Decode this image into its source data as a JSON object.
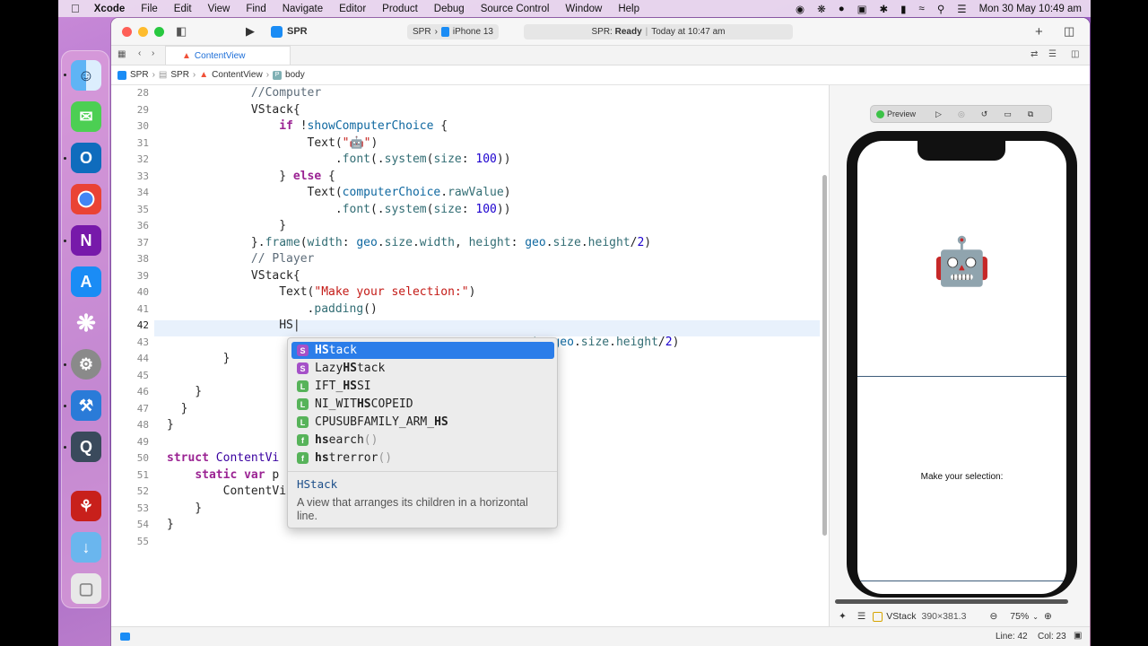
{
  "menubar": {
    "app_name": "Xcode",
    "items": [
      "File",
      "Edit",
      "View",
      "Find",
      "Navigate",
      "Editor",
      "Product",
      "Debug",
      "Source Control",
      "Window",
      "Help"
    ],
    "datetime": "Mon 30 May  10:49 am"
  },
  "toolbar": {
    "project": "SPR",
    "scheme": "SPR",
    "device": "iPhone 13",
    "status_prefix": "SPR:",
    "status_state": "Ready",
    "status_time": "Today at 10:47 am"
  },
  "tab": {
    "label": "ContentView"
  },
  "jumpbar": {
    "items": [
      "SPR",
      "SPR",
      "ContentView",
      "body"
    ]
  },
  "editor": {
    "lines": [
      {
        "n": "28",
        "html": "            <span class=\"cm\">//Computer</span>"
      },
      {
        "n": "29",
        "html": "            VStack{"
      },
      {
        "n": "30",
        "html": "                <span class=\"kw\">if</span> !<span class=\"id\">showComputerChoice</span> {"
      },
      {
        "n": "31",
        "html": "                    Text(<span class=\"str\">\"🤖\"</span>)"
      },
      {
        "n": "32",
        "html": "                        .<span class=\"pr\">font</span>(.<span class=\"pr\">system</span>(<span class=\"pr\">size</span>: <span class=\"nm\">100</span>))"
      },
      {
        "n": "33",
        "html": "                } <span class=\"kw\">else</span> {"
      },
      {
        "n": "34",
        "html": "                    Text(<span class=\"id\">computerChoice</span>.<span class=\"pr\">rawValue</span>)"
      },
      {
        "n": "35",
        "html": "                        .<span class=\"pr\">font</span>(.<span class=\"pr\">system</span>(<span class=\"pr\">size</span>: <span class=\"nm\">100</span>))"
      },
      {
        "n": "36",
        "html": "                }"
      },
      {
        "n": "37",
        "html": "            }.<span class=\"pr\">frame</span>(<span class=\"pr\">width</span>: <span class=\"id\">geo</span>.<span class=\"pr\">size</span>.<span class=\"pr\">width</span>, <span class=\"pr\">height</span>: <span class=\"id\">geo</span>.<span class=\"pr\">size</span>.<span class=\"pr\">height</span>/<span class=\"nm\">2</span>)"
      },
      {
        "n": "38",
        "html": "            <span class=\"cm\">// Player</span>"
      },
      {
        "n": "39",
        "html": "            VStack{"
      },
      {
        "n": "40",
        "html": "                Text(<span class=\"str\">\"Make your selection:\"</span>)"
      },
      {
        "n": "41",
        "html": "                    .<span class=\"pr\">padding</span>()"
      },
      {
        "n": "42",
        "html": "                HS|"
      },
      {
        "n": "43",
        "html": "                                                    <span class=\"pr\">t</span>: <span class=\"id\">geo</span>.<span class=\"pr\">size</span>.<span class=\"pr\">height</span>/<span class=\"nm\">2</span>)"
      },
      {
        "n": "44",
        "html": "        }"
      },
      {
        "n": "45",
        "html": ""
      },
      {
        "n": "46",
        "html": "    }"
      },
      {
        "n": "47",
        "html": "  }"
      },
      {
        "n": "48",
        "html": "}"
      },
      {
        "n": "49",
        "html": ""
      },
      {
        "n": "50",
        "html": "<span class=\"kw\">struct</span> <span class=\"ty\">ContentVi</span>"
      },
      {
        "n": "51",
        "html": "    <span class=\"kw\">static var</span> p"
      },
      {
        "n": "52",
        "html": "        ContentVi"
      },
      {
        "n": "53",
        "html": "    }"
      },
      {
        "n": "54",
        "html": "}"
      },
      {
        "n": "55",
        "html": ""
      }
    ]
  },
  "autocomplete": {
    "items": [
      {
        "badge": "S",
        "color": "#a550c8",
        "html": "<b>HS</b>tack",
        "selected": true
      },
      {
        "badge": "S",
        "color": "#a550c8",
        "html": "Lazy<b>HS</b>tack"
      },
      {
        "badge": "L",
        "color": "#57b35a",
        "html": "IFT_<b>HS</b>SI"
      },
      {
        "badge": "L",
        "color": "#57b35a",
        "html": "NI_WIT<b>HS</b>COPEID"
      },
      {
        "badge": "L",
        "color": "#57b35a",
        "html": "CPUSUBFAMILY_ARM_<b>HS</b>"
      },
      {
        "badge": "f",
        "color": "#57b35a",
        "html": "<b>hs</b>earch<span class=\"dim\">()</span>"
      },
      {
        "badge": "f",
        "color": "#57b35a",
        "html": "<b>hs</b>trerror<span class=\"dim\">()</span>"
      }
    ],
    "doc_title": "HStack",
    "doc_text": "A view that arranges its children in a horizontal line."
  },
  "preview": {
    "label": "Preview",
    "robot_emoji": "🤖",
    "selection_text": "Make your selection:",
    "selected_view": "VStack",
    "view_size": "390×381.3",
    "zoom": "75%"
  },
  "statusbar": {
    "line": "Line: 42",
    "col": "Col: 23"
  }
}
